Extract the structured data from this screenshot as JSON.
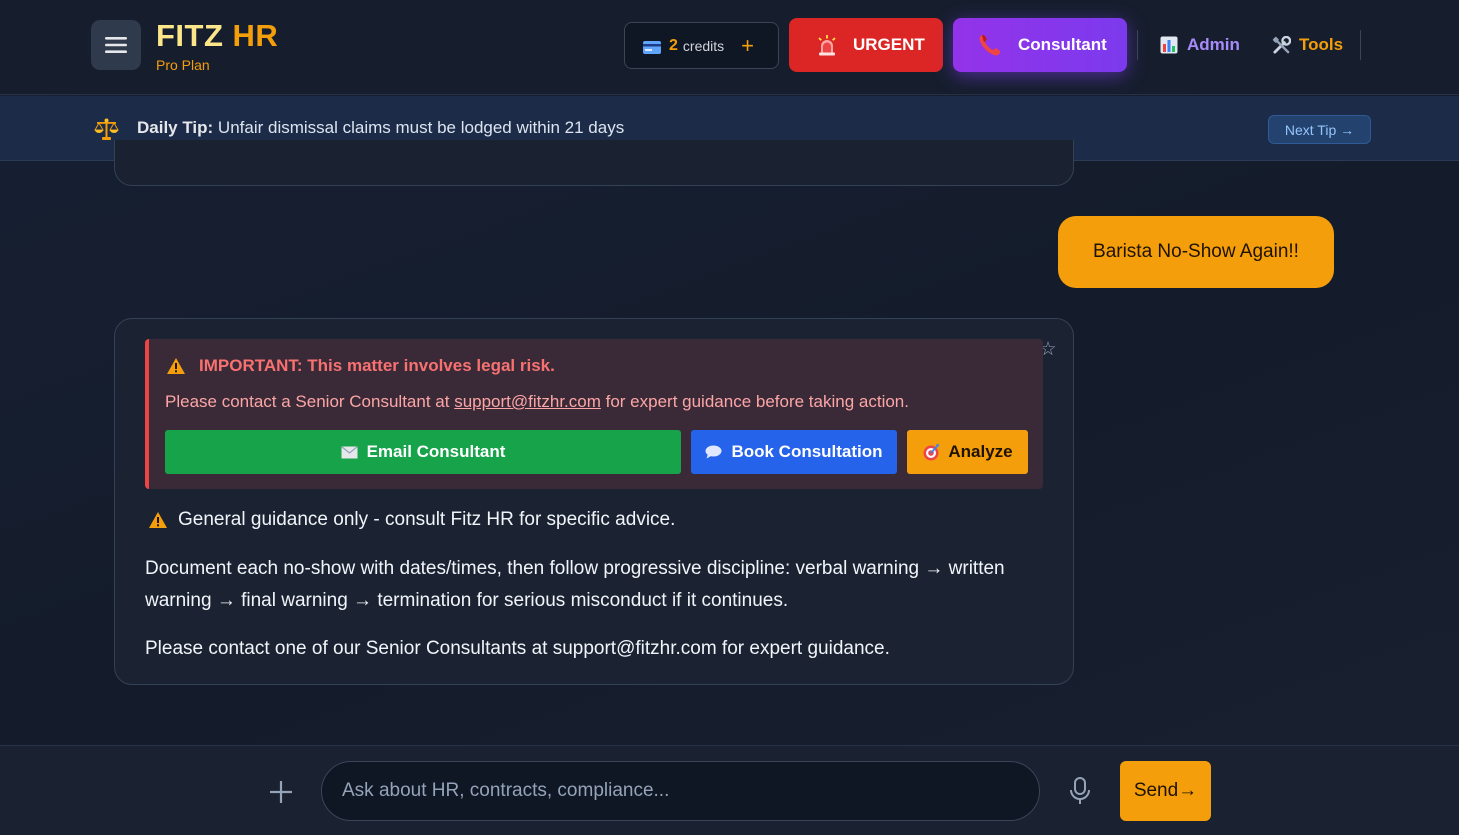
{
  "header": {
    "brand_part1": "FITZ",
    "brand_part2": " HR",
    "plan": "Pro Plan",
    "credits_count": "2",
    "credits_label": "credits",
    "credits_add": "+",
    "urgent_label": "URGENT",
    "consultant_label": "Consultant",
    "admin_label": "Admin",
    "tools_label": "Tools"
  },
  "tip": {
    "prefix": "Daily Tip:",
    "text": " Unfair dismissal claims must be lodged within 21 days",
    "next_label": "Next Tip →"
  },
  "chat": {
    "user_message": "Barista No-Show Again!!",
    "star": "☆",
    "alert": {
      "title": "IMPORTANT: This matter involves legal risk.",
      "body_before": "Please contact a Senior Consultant at ",
      "email": "support@fitzhr.com",
      "body_after": " for expert guidance before taking action.",
      "email_button": "Email Consultant",
      "book_button": "Book Consultation",
      "analyze_button": "Analyze"
    },
    "guidance": "General guidance only - consult Fitz HR for specific advice.",
    "paragraph1": "Document each no-show with dates/times, then follow progressive discipline: verbal warning → written warning → final warning → termination for serious misconduct if it continues.",
    "paragraph2": "Please contact one of our Senior Consultants at support@fitzhr.com for expert guidance."
  },
  "input": {
    "placeholder": "Ask about HR, contracts, compliance...",
    "value": "",
    "send_label": "Send→"
  },
  "colors": {
    "accent": "#f59e0b",
    "urgent": "#dc2626",
    "consultant": "#7c3aed",
    "email_btn": "#16a34a",
    "book_btn": "#2563eb",
    "alert_text": "#f87171"
  },
  "icons": {
    "menu": "hamburger-icon",
    "credits": "credit-card-icon",
    "urgent": "siren-icon",
    "consultant": "phone-icon",
    "admin": "bar-chart-icon",
    "tools": "tools-icon",
    "tip": "scales-icon",
    "warning": "warning-icon",
    "email": "envelope-icon",
    "book": "speech-bubble-icon",
    "analyze": "target-icon",
    "attach": "plus-icon",
    "mic": "microphone-icon"
  }
}
